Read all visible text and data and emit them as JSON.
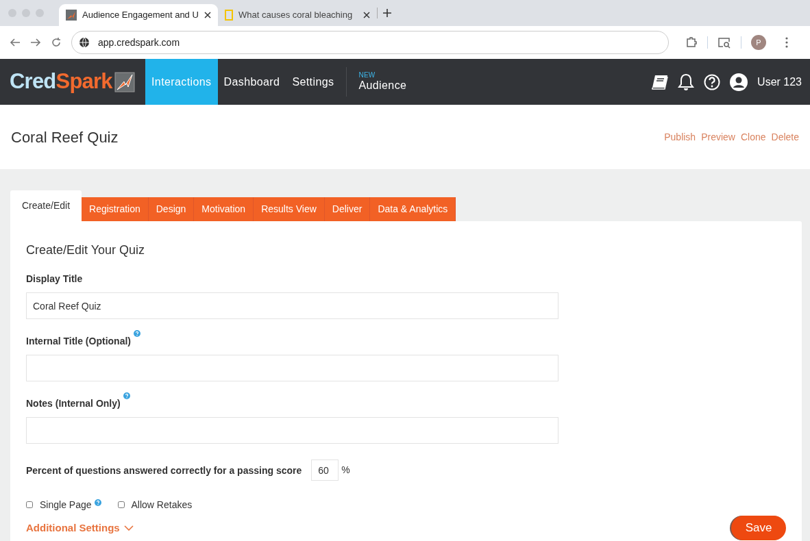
{
  "browser": {
    "tabs": [
      {
        "title": "Audience Engagement and U",
        "selected": true
      },
      {
        "title": "What causes coral bleaching",
        "selected": false
      }
    ],
    "address": "app.credspark.com",
    "profile_initial": "P"
  },
  "nav": {
    "logo": {
      "part_1": "Cred",
      "part_2": "Spark"
    },
    "items": [
      {
        "label": "Interactions",
        "selected": true
      },
      {
        "label": "Dashboard",
        "selected": false
      },
      {
        "label": "Settings",
        "selected": false
      }
    ],
    "new_item": {
      "badge": "NEW",
      "label": "Audience"
    },
    "user": "User 123"
  },
  "page": {
    "title": "Coral Reef Quiz",
    "actions": [
      "Publish",
      "Preview",
      "Clone",
      "Delete"
    ]
  },
  "tabs": [
    {
      "label": "Create/Edit",
      "selected": true
    },
    {
      "label": "Registration",
      "selected": false
    },
    {
      "label": "Design",
      "selected": false
    },
    {
      "label": "Motivation",
      "selected": false
    },
    {
      "label": "Results View",
      "selected": false
    },
    {
      "label": "Deliver",
      "selected": false
    },
    {
      "label": "Data & Analytics",
      "selected": false
    }
  ],
  "form": {
    "heading": "Create/Edit Your Quiz",
    "fields": [
      {
        "label": "Display Title",
        "value": "Coral Reef Quiz",
        "help": false
      },
      {
        "label": "Internal Title (Optional)",
        "help": true
      },
      {
        "label": "Notes (Internal Only)",
        "help": true
      }
    ],
    "passing": {
      "label": "Percent of questions answered correctly for a passing score",
      "value": "60",
      "unit": "%"
    },
    "checkboxes": [
      {
        "label": "Single Page",
        "checked": false,
        "help": true
      },
      {
        "label": "Allow Retakes",
        "checked": false,
        "help": false
      }
    ],
    "additional_settings": "Additional Settings",
    "save": "Save"
  }
}
